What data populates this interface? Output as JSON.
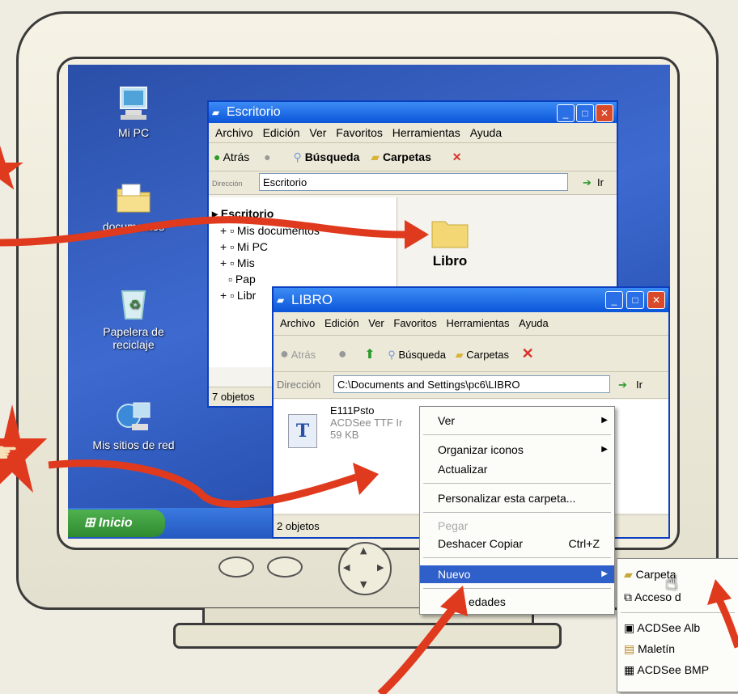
{
  "desktop": {
    "icons": [
      {
        "label": "Mi PC",
        "icon": "computer-icon"
      },
      {
        "label": "documentos",
        "icon": "folder-icon"
      },
      {
        "label": "Papelera de reciclaje",
        "icon": "recycle-bin-icon"
      },
      {
        "label": "Mis sitios de red",
        "icon": "network-icon"
      }
    ],
    "start_label": "Inicio"
  },
  "win1": {
    "title": "Escritorio",
    "menu": [
      "Archivo",
      "Edición",
      "Ver",
      "Favoritos",
      "Herramientas",
      "Ayuda"
    ],
    "back": "Atrás",
    "search": "Búsqueda",
    "folders": "Carpetas",
    "address_label": "Dirección",
    "address": "Escritorio",
    "go": "Ir",
    "tree": [
      "Escritorio",
      "Mis documentos",
      "Mi PC",
      "Mis",
      "Pap",
      "Libr"
    ],
    "folder_name": "Libro",
    "status": "7 objetos"
  },
  "win2": {
    "title": "LIBRO",
    "menu": [
      "Archivo",
      "Edición",
      "Ver",
      "Favoritos",
      "Herramientas",
      "Ayuda"
    ],
    "back": "Atrás",
    "search": "Búsqueda",
    "folders": "Carpetas",
    "address_label": "Dirección",
    "address": "C:\\Documents and Settings\\pc6\\LIBRO",
    "go": "Ir",
    "file": {
      "name": "E111Psto",
      "type": "ACDSee TTF Ir",
      "size": "59 KB"
    },
    "status": "2 objetos"
  },
  "context_menu": {
    "items": [
      {
        "label": "Ver",
        "submenu": true
      },
      {
        "label": "Organizar iconos",
        "submenu": true
      },
      {
        "label": "Actualizar"
      },
      {
        "label": "Personalizar esta carpeta..."
      },
      {
        "label": "Pegar",
        "disabled": true
      },
      {
        "label": "Deshacer Copiar",
        "shortcut": "Ctrl+Z"
      },
      {
        "label": "Nuevo",
        "submenu": true,
        "highlighted": true
      },
      {
        "label": "edades"
      }
    ]
  },
  "submenu": {
    "items": [
      {
        "label": "Carpeta",
        "icon": "folder-icon"
      },
      {
        "label": "Acceso d",
        "icon": "shortcut-icon"
      },
      {
        "label": "ACDSee Alb",
        "icon": "album-icon"
      },
      {
        "label": "Maletín",
        "icon": "briefcase-icon"
      },
      {
        "label": "ACDSee BMP",
        "icon": "bmp-icon"
      }
    ]
  },
  "colors": {
    "accent_red": "#e03a1e",
    "xp_blue": "#0b55d9",
    "menu_highlight": "#2f5fc8"
  }
}
